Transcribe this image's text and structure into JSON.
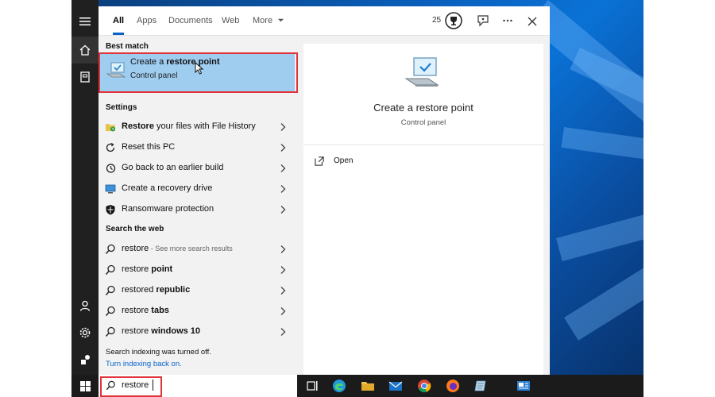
{
  "tabs": [
    {
      "label": "All",
      "active": true
    },
    {
      "label": "Apps"
    },
    {
      "label": "Documents"
    },
    {
      "label": "Web"
    },
    {
      "label": "More"
    }
  ],
  "header": {
    "points": "25"
  },
  "best_match": {
    "section_label": "Best match",
    "title_prefix": "Create a ",
    "title_bold": "restore point",
    "subtitle": "Control panel"
  },
  "settings": {
    "section_label": "Settings",
    "items": [
      {
        "bold": "Restore",
        "rest": " your files with File History"
      },
      {
        "bold": "",
        "rest": "Reset this PC"
      },
      {
        "bold": "",
        "rest": "Go back to an earlier build"
      },
      {
        "bold": "",
        "rest": "Create a recovery drive"
      },
      {
        "bold": "",
        "rest": "Ransomware protection"
      }
    ]
  },
  "web": {
    "section_label": "Search the web",
    "items": [
      {
        "normal": "restore",
        "bold": "",
        "hint": " - See more search results"
      },
      {
        "normal": "restore ",
        "bold": "point",
        "hint": ""
      },
      {
        "normal": "restored ",
        "bold": "republic",
        "hint": ""
      },
      {
        "normal": "restore ",
        "bold": "tabs",
        "hint": ""
      },
      {
        "normal": "restore ",
        "bold": "windows 10",
        "hint": ""
      }
    ]
  },
  "indexing": {
    "message": "Search indexing was turned off.",
    "link": "Turn indexing back on."
  },
  "preview": {
    "title": "Create a restore point",
    "subtitle": "Control panel",
    "action": "Open"
  },
  "search": {
    "value": "restore"
  },
  "colors": {
    "accent": "#0a64c8",
    "highlight": "#9fcdf0",
    "callout": "#e0333a"
  }
}
